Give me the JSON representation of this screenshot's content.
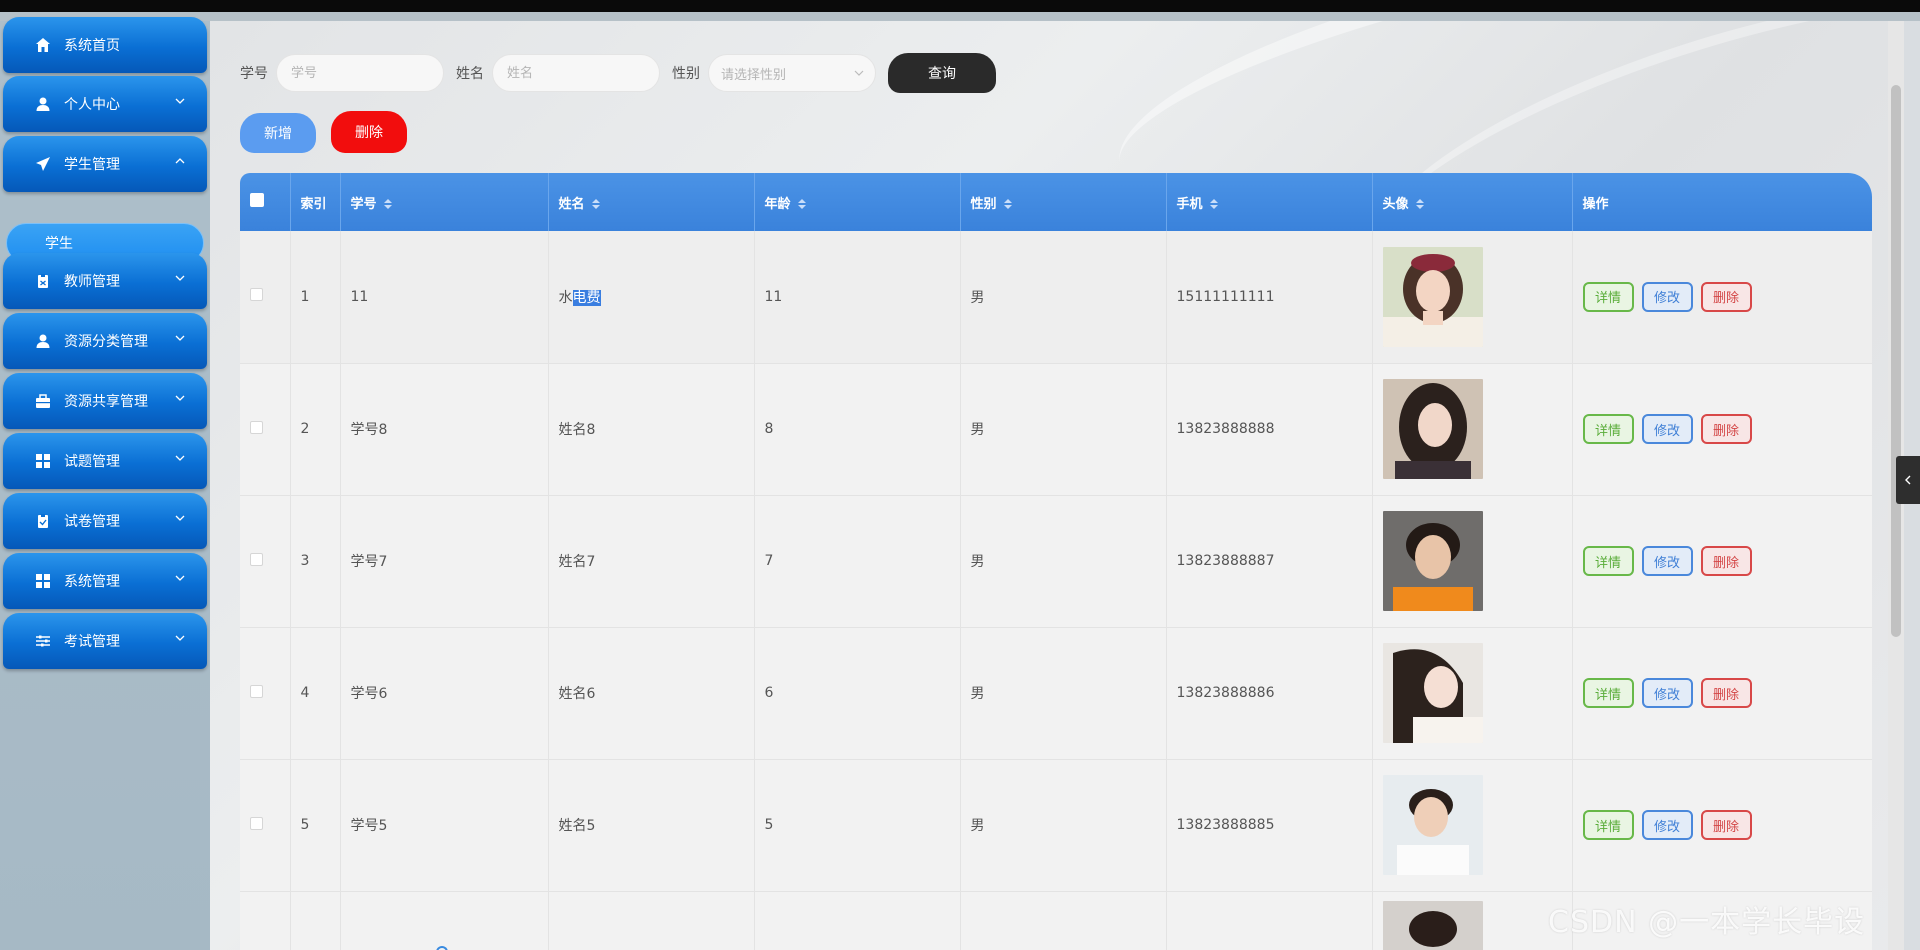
{
  "sidebar": {
    "items": [
      {
        "label": "系统首页",
        "icon": "home-icon"
      },
      {
        "label": "个人中心",
        "icon": "user-icon"
      },
      {
        "label": "学生管理",
        "icon": "send-icon"
      },
      {
        "label": "教师管理",
        "icon": "clipboard-icon"
      },
      {
        "label": "资源分类管理",
        "icon": "user-icon"
      },
      {
        "label": "资源共享管理",
        "icon": "briefcase-icon"
      },
      {
        "label": "试题管理",
        "icon": "grid-icon"
      },
      {
        "label": "试卷管理",
        "icon": "clipboard-check-icon"
      },
      {
        "label": "系统管理",
        "icon": "grid-icon"
      },
      {
        "label": "考试管理",
        "icon": "sliders-icon"
      }
    ],
    "active_sub": "学生"
  },
  "search": {
    "student_no_label": "学号",
    "student_no_placeholder": "学号",
    "name_label": "姓名",
    "name_placeholder": "姓名",
    "gender_label": "性别",
    "gender_placeholder": "请选择性别",
    "query_label": "查询"
  },
  "actions": {
    "add_label": "新增",
    "delete_label": "删除"
  },
  "table": {
    "headers": [
      "索引",
      "学号",
      "姓名",
      "年龄",
      "性别",
      "手机",
      "头像",
      "操作"
    ],
    "rows": [
      {
        "index": "1",
        "student_no": "11",
        "name_pre": "水",
        "name_sel": "电费",
        "age": "11",
        "gender": "男",
        "phone": "15111111111"
      },
      {
        "index": "2",
        "student_no": "学号8",
        "name": "姓名8",
        "age": "8",
        "gender": "男",
        "phone": "13823888888"
      },
      {
        "index": "3",
        "student_no": "学号7",
        "name": "姓名7",
        "age": "7",
        "gender": "男",
        "phone": "13823888887"
      },
      {
        "index": "4",
        "student_no": "学号6",
        "name": "姓名6",
        "age": "6",
        "gender": "男",
        "phone": "13823888886"
      },
      {
        "index": "5",
        "student_no": "学号5",
        "name": "姓名5",
        "age": "5",
        "gender": "男",
        "phone": "13823888885"
      }
    ],
    "row_actions": {
      "detail": "详情",
      "edit": "修改",
      "delete": "删除"
    }
  },
  "watermark": "CSDN @一本学长毕设",
  "colors": {
    "menu": "#0a6fd4",
    "header": "#3a82db",
    "query_button": "#2a2a2a",
    "add_button": "#5b9cf0",
    "delete_button": "#f20d0d"
  }
}
